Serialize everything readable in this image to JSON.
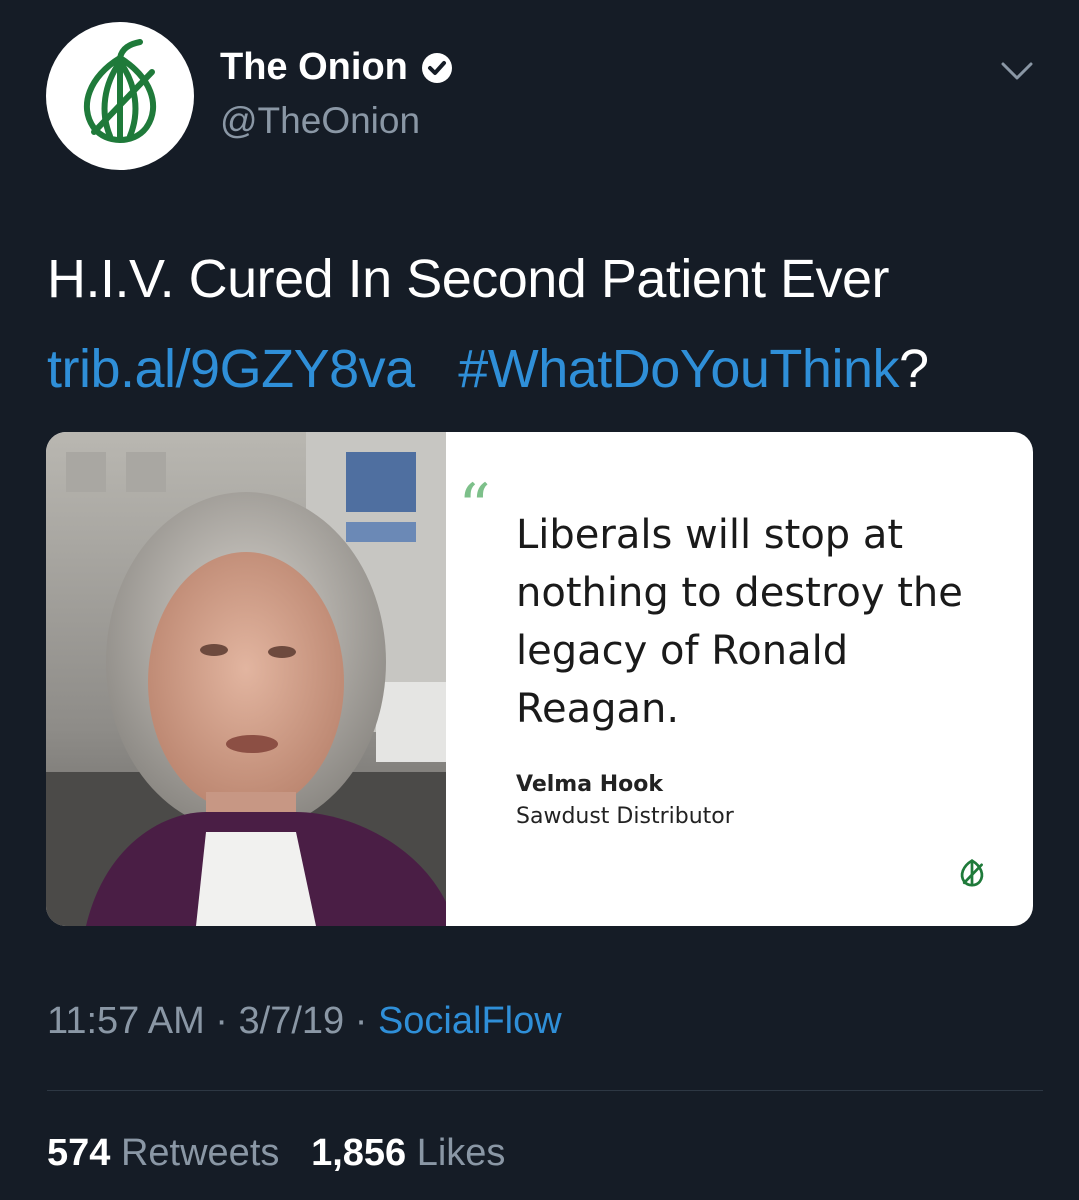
{
  "header": {
    "display_name": "The Onion",
    "handle": "@TheOnion",
    "avatar_icon": "onion-logo-icon",
    "verified_icon": "verified-badge-icon",
    "menu_icon": "chevron-down-icon"
  },
  "tweet": {
    "headline": "H.I.V. Cured In Second Patient Ever",
    "link": "trib.al/9GZY8va",
    "hashtag": "#WhatDoYouThink",
    "hashtag_suffix": "?"
  },
  "card": {
    "quote": "Liberals will stop at nothing to destroy the legacy of Ronald Reagan.",
    "author_name": "Velma Hook",
    "author_title": "Sawdust Distributor",
    "brand_icon": "onion-logo-icon"
  },
  "meta": {
    "time": "11:57 AM",
    "separator": "·",
    "date": "3/7/19",
    "source": "SocialFlow"
  },
  "stats": {
    "retweets_count": "574",
    "retweets_label": "Retweets",
    "likes_count": "1,856",
    "likes_label": "Likes"
  },
  "colors": {
    "background": "#151c26",
    "link": "#2f8fd8",
    "muted": "#8a97a5",
    "onion_green": "#1f7a3a"
  }
}
